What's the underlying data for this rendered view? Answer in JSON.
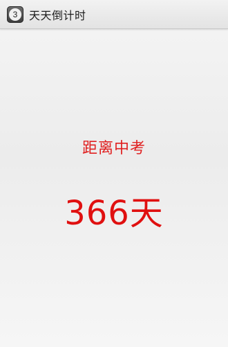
{
  "app": {
    "icon_text": "3",
    "title": "天天倒计时"
  },
  "countdown": {
    "label": "距离中考",
    "value": "366天"
  },
  "colors": {
    "accent": "#e01010"
  }
}
